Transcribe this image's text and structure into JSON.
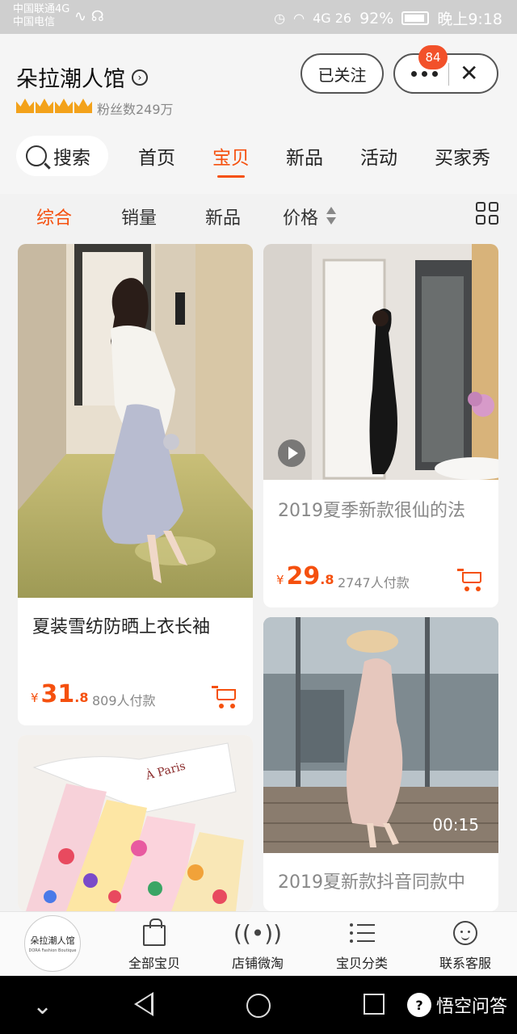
{
  "status_bar": {
    "carrier_1": "中国联通4G",
    "carrier_2": "中国电信",
    "network": "4G 26",
    "battery": "92%",
    "time": "晚上9:18"
  },
  "shop": {
    "name": "朵拉潮人馆",
    "crown_count": 4,
    "fans": "粉丝数249万",
    "follow_label": "已关注",
    "badge_count": "84"
  },
  "nav": {
    "search_label": "搜索",
    "tabs": [
      "首页",
      "宝贝",
      "新品",
      "活动",
      "买家秀"
    ],
    "active_tab": "宝贝"
  },
  "filters": {
    "items": [
      "综合",
      "销量",
      "新品",
      "价格"
    ],
    "active": "综合"
  },
  "products": [
    {
      "title": "夏装雪纺防晒上衣长袖",
      "price_int": "31",
      "price_dec": ".8",
      "currency": "¥",
      "paid": "809人付款"
    },
    {
      "title": "2019夏季新款很仙的法",
      "price_int": "29",
      "price_dec": ".8",
      "currency": "¥",
      "paid": "2747人付款",
      "has_video": true
    },
    {
      "title": "2019夏新款抖音同款中",
      "video_duration": "00:15"
    },
    {
      "title": ""
    }
  ],
  "bottom_bar": {
    "logo_text": "朵拉潮人馆",
    "logo_sub": "DORA Fashion Boutique",
    "items": [
      "全部宝贝",
      "店铺微淘",
      "宝贝分类",
      "联系客服"
    ]
  },
  "watermark": "悟空问答",
  "colors": {
    "accent": "#f5500e",
    "badge": "#f2512a",
    "crown": "#f3a21b"
  }
}
